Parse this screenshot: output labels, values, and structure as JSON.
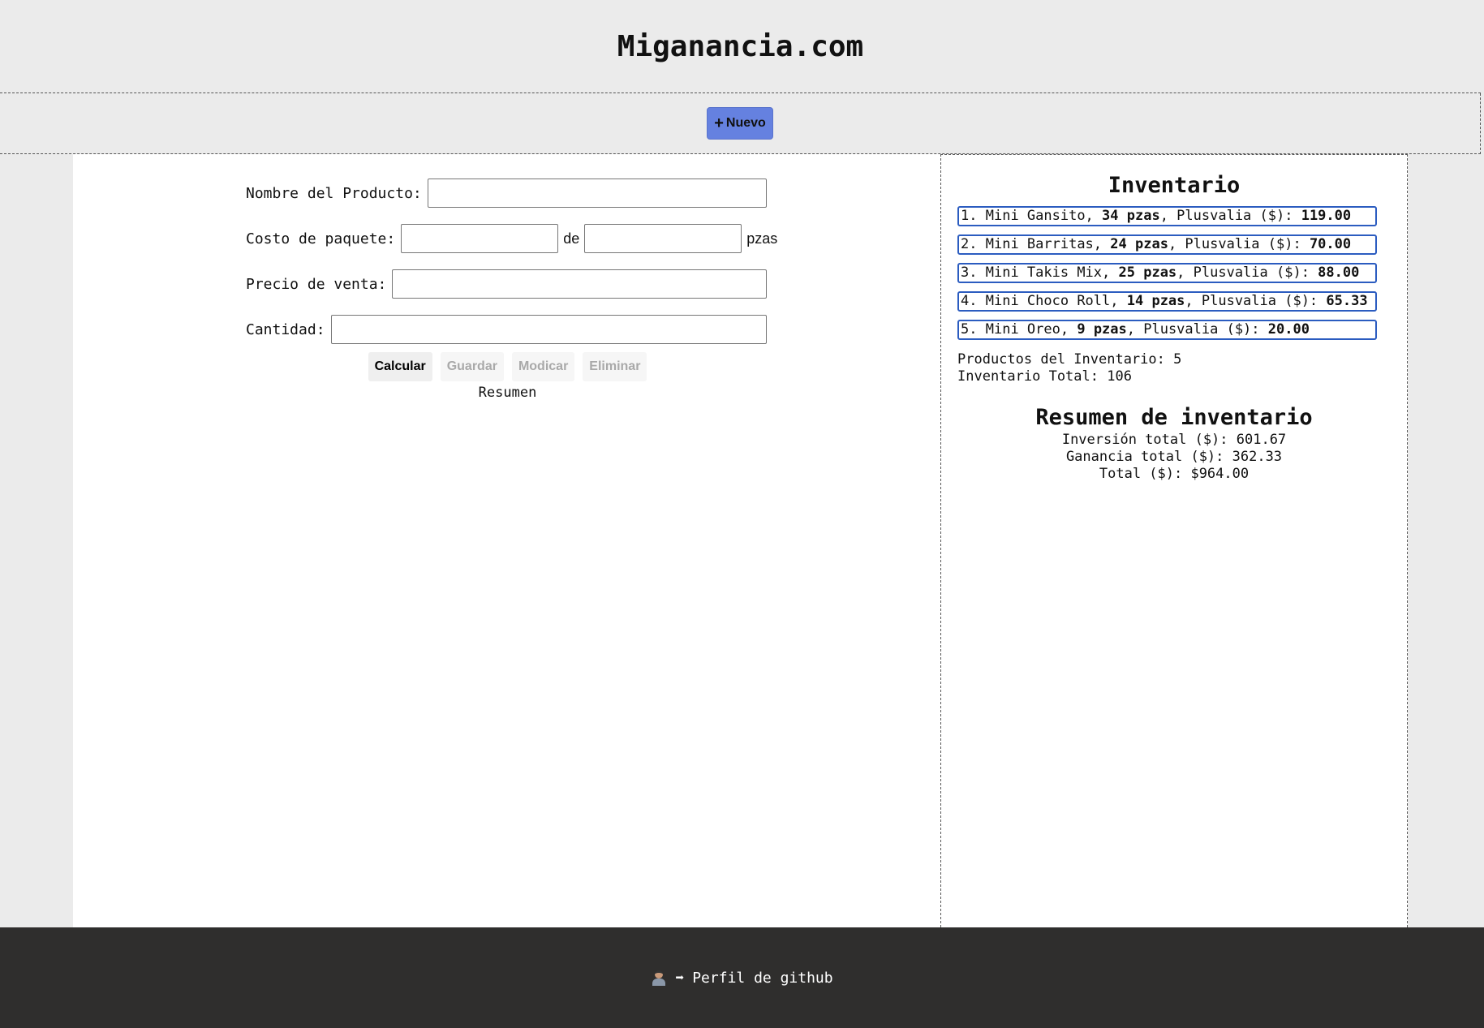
{
  "header": {
    "title": "Miganancia.com"
  },
  "toolbar": {
    "new_icon": "+",
    "new_label": "Nuevo"
  },
  "form": {
    "product_name_label": "Nombre del Producto:",
    "package_cost_label": "Costo de paquete:",
    "package_of": "de",
    "package_unit": "pzas",
    "sale_price_label": "Precio de venta:",
    "quantity_label": "Cantidad:",
    "values": {
      "product_name": "",
      "package_cost": "",
      "package_pieces": "",
      "sale_price": "",
      "quantity": ""
    }
  },
  "actions": {
    "calcular": "Calcular",
    "guardar": "Guardar",
    "modificar": "Modicar",
    "eliminar": "Eliminar",
    "resumen": "Resumen"
  },
  "inventory": {
    "title": "Inventario",
    "items": [
      {
        "index": "1.",
        "name": "Mini Gansito,",
        "qty": "34 pzas",
        "label": ", Plusvalia ($): ",
        "profit": "119.00"
      },
      {
        "index": "2.",
        "name": "Mini Barritas,",
        "qty": "24 pzas",
        "label": ", Plusvalia ($): ",
        "profit": "70.00"
      },
      {
        "index": "3.",
        "name": "Mini Takis Mix,",
        "qty": "25 pzas",
        "label": ", Plusvalia ($): ",
        "profit": "88.00"
      },
      {
        "index": "4.",
        "name": "Mini Choco Roll,",
        "qty": "14 pzas",
        "label": ", Plusvalia ($): ",
        "profit": "65.33"
      },
      {
        "index": "5.",
        "name": "Mini Oreo,",
        "qty": "9 pzas",
        "label": ", Plusvalia ($): ",
        "profit": "20.00"
      }
    ],
    "products_count": "Productos del Inventario: 5",
    "total_count": "Inventario Total: 106"
  },
  "summary": {
    "title": "Resumen de inventario",
    "investment": "Inversión total ($): 601.67",
    "profit": "Ganancia total ($): 362.33",
    "total": "Total ($): $964.00"
  },
  "footer": {
    "avatar_icon": "person-icon",
    "arrow": "➡",
    "link_label": "Perfil de github"
  },
  "colors": {
    "accent": "#6581e0",
    "item_border": "#2b5cc0",
    "footer_bg": "#2f2e2d",
    "page_bg": "#ebebeb"
  }
}
